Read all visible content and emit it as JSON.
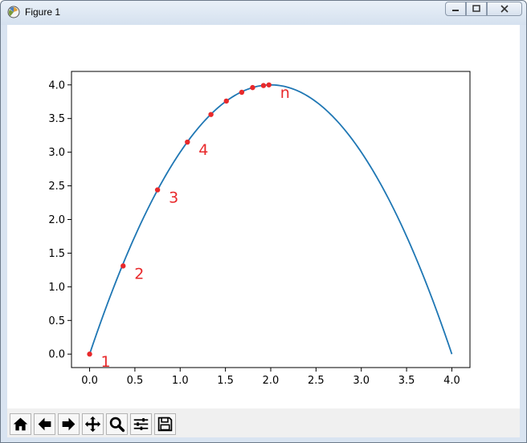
{
  "window": {
    "title": "Figure 1",
    "app_icon": "matplotlib-figure-icon",
    "buttons": [
      "minimize-icon",
      "maximize-icon",
      "close-icon"
    ]
  },
  "toolbar": {
    "buttons": [
      {
        "name": "home-icon",
        "tooltip": "Home"
      },
      {
        "name": "back-arrow-icon",
        "tooltip": "Back"
      },
      {
        "name": "forward-arrow-icon",
        "tooltip": "Forward"
      },
      {
        "name": "pan-icon",
        "tooltip": "Pan"
      },
      {
        "name": "zoom-icon",
        "tooltip": "Zoom"
      },
      {
        "name": "subplots-icon",
        "tooltip": "Subplots"
      },
      {
        "name": "save-icon",
        "tooltip": "Save"
      }
    ]
  },
  "chart_data": {
    "type": "line",
    "title": "",
    "xlabel": "",
    "ylabel": "",
    "xlim": [
      -0.2,
      4.2
    ],
    "ylim": [
      -0.2,
      4.2
    ],
    "xticks": [
      "0.0",
      "0.5",
      "1.0",
      "1.5",
      "2.0",
      "2.5",
      "3.0",
      "3.5",
      "4.0"
    ],
    "yticks": [
      "0.0",
      "0.5",
      "1.0",
      "1.5",
      "2.0",
      "2.5",
      "3.0",
      "3.5",
      "4.0"
    ],
    "grid": false,
    "colors": {
      "line": "#1f77b4",
      "points": "#e8292b"
    },
    "series": [
      {
        "kind": "curve",
        "function": "y = x * (4 - x)",
        "x_range": [
          0,
          4
        ]
      },
      {
        "kind": "points",
        "x": [
          0.0,
          0.37,
          0.75,
          1.08,
          1.34,
          1.51,
          1.68,
          1.8,
          1.92,
          1.98
        ],
        "y": [
          0.0,
          1.31,
          2.44,
          3.15,
          3.56,
          3.76,
          3.89,
          3.96,
          3.99,
          4.0
        ]
      }
    ],
    "annotations": [
      {
        "text": "1",
        "x": 0.0,
        "y": 0.0
      },
      {
        "text": "2",
        "x": 0.37,
        "y": 1.31
      },
      {
        "text": "3",
        "x": 0.75,
        "y": 2.44
      },
      {
        "text": "4",
        "x": 1.08,
        "y": 3.15
      },
      {
        "text": "n",
        "x": 1.98,
        "y": 4.0
      }
    ]
  }
}
